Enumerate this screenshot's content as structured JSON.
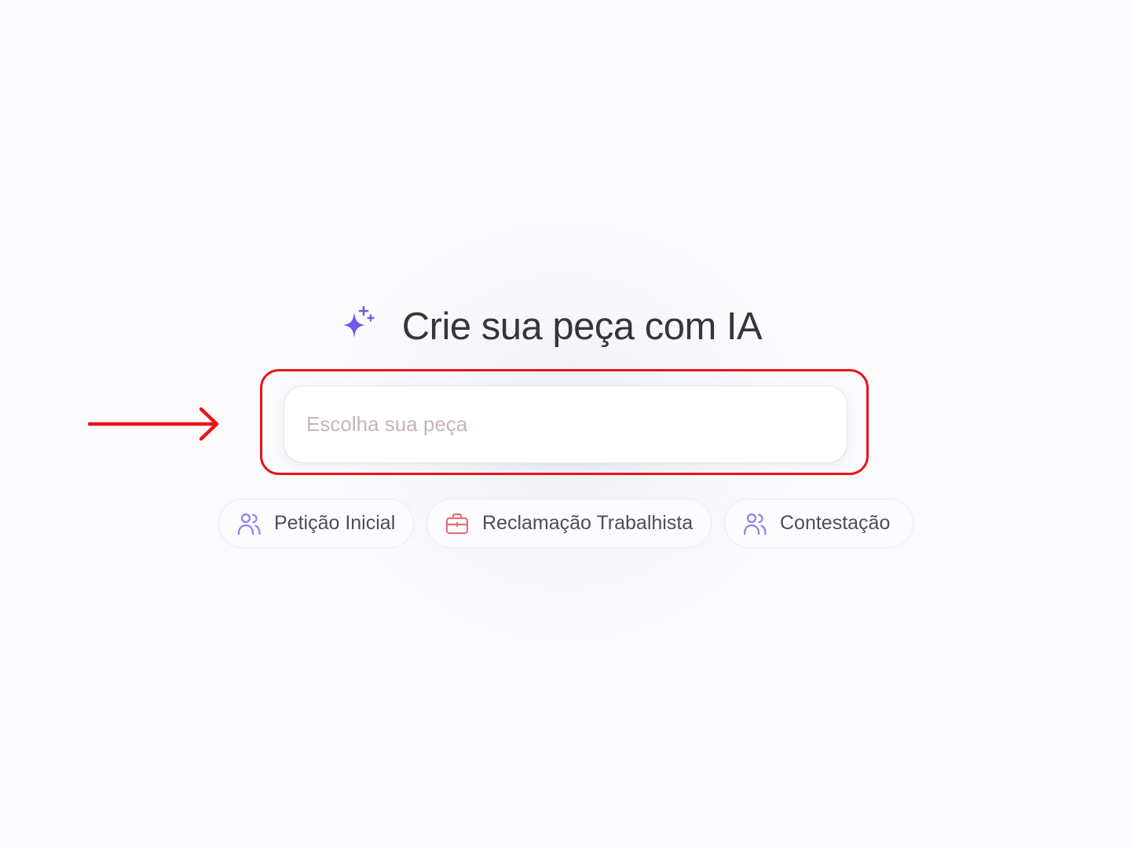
{
  "hero": {
    "title": "Crie sua peça com IA",
    "icon": "sparkle-icon"
  },
  "search": {
    "placeholder": "Escolha sua peça",
    "value": ""
  },
  "suggestions": [
    {
      "label": "Petição Inicial",
      "icon": "users-icon"
    },
    {
      "label": "Reclamação Trabalhista",
      "icon": "briefcase-icon"
    },
    {
      "label": "Contestação",
      "icon": "users-icon"
    }
  ],
  "colors": {
    "accent": "#6c5ce7",
    "highlight": "#e8141b",
    "users_icon": "#8b7ff0",
    "briefcase_icon": "#e0727a"
  }
}
